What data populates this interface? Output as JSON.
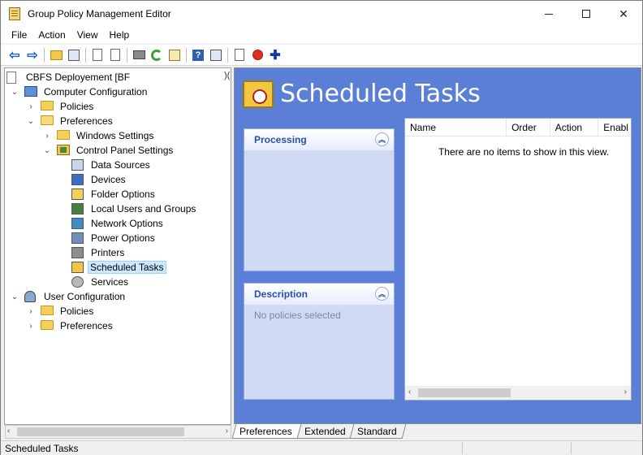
{
  "window": {
    "title": "Group Policy Management Editor"
  },
  "menu": [
    "File",
    "Action",
    "View",
    "Help"
  ],
  "toolbar": {
    "icons": [
      "back-arrow-icon",
      "forward-arrow-icon",
      "up-folder-icon",
      "show-hide-tree-icon",
      "copy-icon",
      "paste-icon",
      "print-icon",
      "refresh-icon",
      "export-list-icon",
      "help-icon",
      "properties-icon",
      "xml-icon",
      "stop-icon",
      "add-icon"
    ]
  },
  "tree": {
    "root": "CBFS Deployement [BF",
    "computer_configuration": "Computer Configuration",
    "policies": "Policies",
    "preferences": "Preferences",
    "windows_settings": "Windows Settings",
    "control_panel_settings": "Control Panel Settings",
    "cp_items": [
      "Data Sources",
      "Devices",
      "Folder Options",
      "Local Users and Groups",
      "Network Options",
      "Power Options",
      "Printers",
      "Scheduled Tasks",
      "Services"
    ],
    "user_configuration": "User Configuration",
    "user_policies": "Policies",
    "user_preferences": "Preferences"
  },
  "content": {
    "title": "Scheduled Tasks",
    "processing_label": "Processing",
    "description_label": "Description",
    "description_text": "No policies selected",
    "columns": [
      "Name",
      "Order",
      "Action",
      "Enabl"
    ],
    "empty_message": "There are no items to show in this view."
  },
  "tabs": [
    "Preferences",
    "Extended",
    "Standard"
  ],
  "status": {
    "text": "Scheduled Tasks"
  },
  "colors": {
    "content_bg": "#5b7fd6",
    "panel_bg": "#d0daf5",
    "selection": "#cce8ff"
  }
}
